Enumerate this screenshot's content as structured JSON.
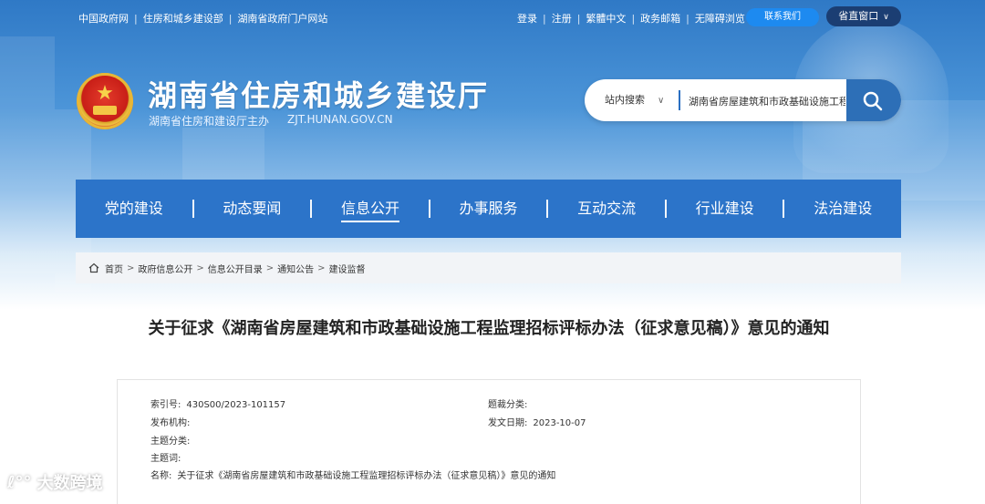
{
  "top_links": [
    "中国政府网",
    "住房和城乡建设部",
    "湖南省政府门户网站"
  ],
  "right_links": [
    "登录",
    "注册",
    "繁體中文",
    "政务邮箱",
    "无障碍浏览"
  ],
  "contact_button": "联系我们",
  "province_button": "省直窗口",
  "site": {
    "title": "湖南省住房和城乡建设厅",
    "host": "湖南省住房和建设厅主办",
    "domain": "ZJT.HUNAN.GOV.CN"
  },
  "search": {
    "scope": "站内搜索",
    "value": "湖南省房屋建筑和市政基础设施工程监"
  },
  "nav": [
    "党的建设",
    "动态要闻",
    "信息公开",
    "办事服务",
    "互动交流",
    "行业建设",
    "法治建设"
  ],
  "nav_active": "信息公开",
  "breadcrumb": [
    "首页",
    "政府信息公开",
    "信息公开目录",
    "通知公告",
    "建设监督"
  ],
  "doc": {
    "title": "关于征求《湖南省房屋建筑和市政基础设施工程监理招标评标办法（征求意见稿）》意见的通知"
  },
  "meta": {
    "index_label": "索引号:",
    "index_value": "430S00/2023-101157",
    "category_label": "题裁分类:",
    "category_value": "",
    "publisher_label": "发布机构:",
    "publisher_value": "",
    "date_label": "发文日期:",
    "date_value": "2023-10-07",
    "topic_label": "主题分类:",
    "topic_value": "",
    "keywords_label": "主题词:",
    "keywords_value": "",
    "name_label": "名称:",
    "name_value": "关于征求《湖南省房屋建筑和市政基础设施工程监理招标评标办法（征求意见稿）》意见的通知"
  },
  "watermark": "大数跨境",
  "colors": {
    "nav_bg": "#2c74c9",
    "contact_btn": "#1d8af0",
    "province_btn": "#1b3e73",
    "search_btn": "#2d6fb7"
  }
}
